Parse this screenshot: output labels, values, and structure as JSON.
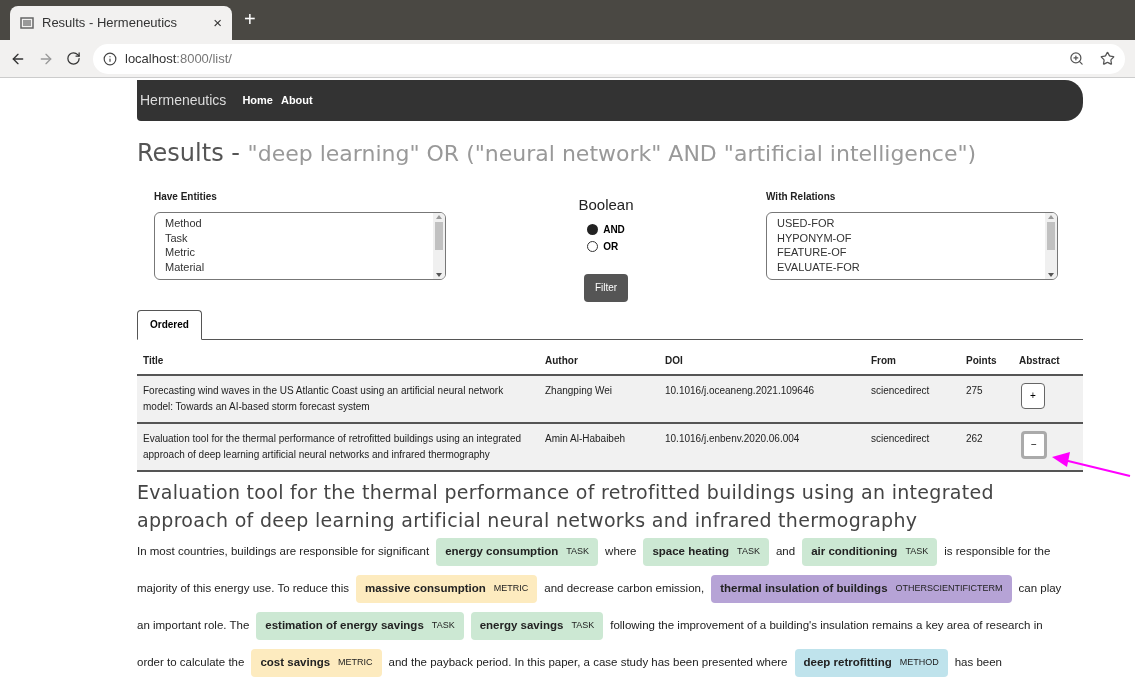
{
  "browser": {
    "tab_title": "Results - Hermeneutics",
    "close": "×",
    "new_tab": "+",
    "url_host": "localhost",
    "url_path": ":8000/list/"
  },
  "navbar": {
    "brand": "Hermeneutics",
    "links": [
      "Home",
      "About"
    ]
  },
  "heading": {
    "prefix": "Results - ",
    "query": "\"deep learning\" OR (\"neural network\" AND \"artificial intelligence\")"
  },
  "filters": {
    "entities": {
      "label": "Have Entities",
      "options": [
        "Method",
        "Task",
        "Metric",
        "Material"
      ]
    },
    "boolean": {
      "label": "Boolean",
      "options": [
        {
          "label": "AND",
          "selected": true
        },
        {
          "label": "OR",
          "selected": false
        }
      ]
    },
    "filter_button": "Filter",
    "relations": {
      "label": "With Relations",
      "options": [
        "USED-FOR",
        "HYPONYM-OF",
        "FEATURE-OF",
        "EVALUATE-FOR"
      ]
    }
  },
  "tabs": [
    {
      "label": "Ordered",
      "selected": true
    }
  ],
  "table": {
    "columns": [
      "Title",
      "Author",
      "DOI",
      "From",
      "Points",
      "Abstract"
    ],
    "rows": [
      {
        "title": "Forecasting wind waves in the US Atlantic Coast using an artificial neural network model: Towards an AI-based storm forecast system",
        "author": "Zhangping Wei",
        "doi": "10.1016/j.oceaneng.2021.109646",
        "from": "sciencedirect",
        "points": "275",
        "toggle": "+",
        "expanded": false
      },
      {
        "title": "Evaluation tool for the thermal performance of retrofitted buildings using an integrated approach of deep learning artificial neural networks and infrared thermography",
        "author": "Amin Al-Habaibeh",
        "doi": "10.1016/j.enbenv.2020.06.004",
        "from": "sciencedirect",
        "points": "262",
        "toggle": "−",
        "expanded": true
      }
    ]
  },
  "abstract": {
    "title": "Evaluation tool for the thermal performance of retrofitted buildings using an integrated approach of deep learning artificial neural networks and infrared thermography",
    "lines": [
      [
        {
          "kind": "text",
          "text": "In most countries, buildings are responsible for significant"
        },
        {
          "kind": "entity",
          "text": "energy consumption",
          "type": "TASK",
          "color": "#cce8d3"
        },
        {
          "kind": "text",
          "text": "where"
        },
        {
          "kind": "entity",
          "text": "space heating",
          "type": "TASK",
          "color": "#cce8d3"
        },
        {
          "kind": "text",
          "text": "and"
        },
        {
          "kind": "entity",
          "text": "air conditioning",
          "type": "TASK",
          "color": "#cce8d3"
        },
        {
          "kind": "text",
          "text": "is responsible for the"
        }
      ],
      [
        {
          "kind": "text",
          "text": "majority of this energy use. To reduce this"
        },
        {
          "kind": "entity",
          "text": "massive consumption",
          "type": "METRIC",
          "color": "#fdebbf"
        },
        {
          "kind": "text",
          "text": "and decrease carbon emission,"
        },
        {
          "kind": "entity",
          "text": "thermal insulation of buildings",
          "type": "OTHERSCIENTIFICTERM",
          "color": "#b6a3d6"
        },
        {
          "kind": "text",
          "text": "can play"
        }
      ],
      [
        {
          "kind": "text",
          "text": "an important role. The"
        },
        {
          "kind": "entity",
          "text": "estimation of energy savings",
          "type": "TASK",
          "color": "#cce8d3"
        },
        {
          "kind": "entity",
          "text": "energy savings",
          "type": "TASK",
          "color": "#cce8d3"
        },
        {
          "kind": "text",
          "text": "following the improvement of a building's insulation remains a key area of research in"
        }
      ],
      [
        {
          "kind": "text",
          "text": "order to calculate the"
        },
        {
          "kind": "entity",
          "text": "cost savings",
          "type": "METRIC",
          "color": "#fdebbf"
        },
        {
          "kind": "text",
          "text": "and the payback period. In this paper, a case study has been presented where"
        },
        {
          "kind": "entity",
          "text": "deep retrofitting",
          "type": "METHOD",
          "color": "#bfe3ec"
        },
        {
          "kind": "text",
          "text": "has been"
        }
      ]
    ]
  }
}
